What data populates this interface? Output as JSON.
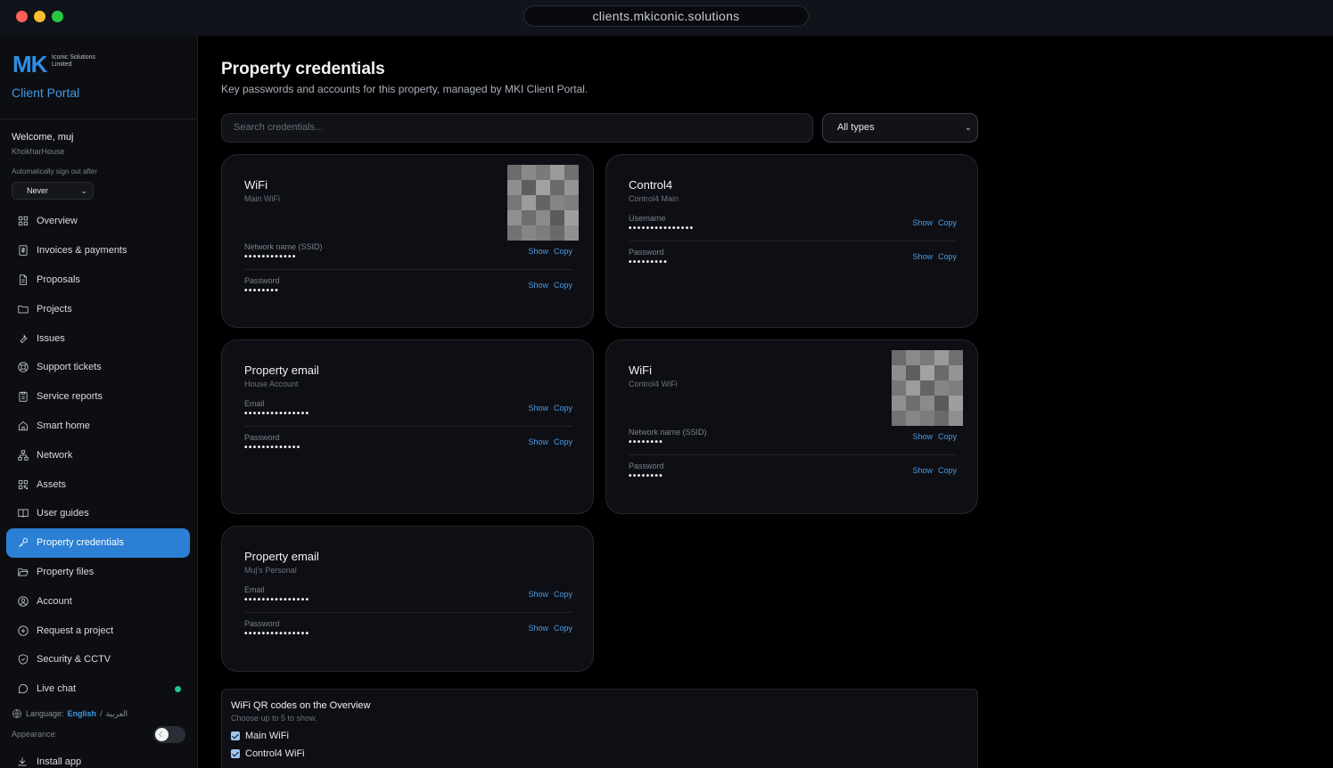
{
  "window": {
    "url": "clients.mkiconic.solutions"
  },
  "brand": {
    "logo_text": "MK",
    "logo_sub": "Iconic Solutions Limited",
    "portal_title": "Client Portal"
  },
  "user": {
    "welcome": "Welcome, muj",
    "property": "KhokharHouse",
    "auto_signout_label": "Automatically sign out after",
    "auto_signout_value": "Never"
  },
  "nav": [
    {
      "label": "Overview",
      "icon": "grid-icon"
    },
    {
      "label": "Invoices & payments",
      "icon": "invoice-icon"
    },
    {
      "label": "Proposals",
      "icon": "document-icon"
    },
    {
      "label": "Projects",
      "icon": "folder-icon"
    },
    {
      "label": "Issues",
      "icon": "wrench-icon"
    },
    {
      "label": "Support tickets",
      "icon": "lifebuoy-icon"
    },
    {
      "label": "Service reports",
      "icon": "clipboard-icon"
    },
    {
      "label": "Smart home",
      "icon": "home-icon"
    },
    {
      "label": "Network",
      "icon": "network-icon"
    },
    {
      "label": "Assets",
      "icon": "qr-grid-icon"
    },
    {
      "label": "User guides",
      "icon": "book-icon"
    },
    {
      "label": "Property credentials",
      "icon": "key-icon",
      "active": true
    },
    {
      "label": "Property files",
      "icon": "folder-open-icon"
    },
    {
      "label": "Account",
      "icon": "user-circle-icon"
    },
    {
      "label": "Request a project",
      "icon": "plus-circle-icon"
    },
    {
      "label": "Security & CCTV",
      "icon": "shield-icon"
    },
    {
      "label": "Live chat",
      "icon": "chat-icon",
      "online": true
    }
  ],
  "footer": {
    "language_label": "Language:",
    "language_en": "English",
    "language_sep": "/",
    "language_ar": "العربية",
    "appearance_label": "Appearance:",
    "install_label": "Install app"
  },
  "page": {
    "title": "Property credentials",
    "subtitle": "Key passwords and accounts for this property, managed by MKI Client Portal.",
    "search_placeholder": "Search credentials...",
    "type_filter": "All types"
  },
  "actions": {
    "show": "Show",
    "copy": "Copy"
  },
  "cards": [
    {
      "title": "WiFi",
      "subtitle": "Main WiFi",
      "has_qr": true,
      "fields": [
        {
          "label": "Network name (SSID)",
          "value": "••••••••••••"
        },
        {
          "label": "Password",
          "value": "••••••••"
        }
      ]
    },
    {
      "title": "Control4",
      "subtitle": "Control4 Main",
      "has_qr": false,
      "fields": [
        {
          "label": "Username",
          "value": "•••••••••••••••"
        },
        {
          "label": "Password",
          "value": "•••••••••"
        }
      ]
    },
    {
      "title": "Property email",
      "subtitle": "House Account",
      "has_qr": false,
      "fields": [
        {
          "label": "Email",
          "value": "•••••••••••••••"
        },
        {
          "label": "Password",
          "value": "•••••••••••••"
        }
      ]
    },
    {
      "title": "WiFi",
      "subtitle": "Control4 WiFi",
      "has_qr": true,
      "fields": [
        {
          "label": "Network name (SSID)",
          "value": "••••••••"
        },
        {
          "label": "Password",
          "value": "••••••••"
        }
      ]
    },
    {
      "title": "Property email",
      "subtitle": "Muj's Personal",
      "has_qr": false,
      "fields": [
        {
          "label": "Email",
          "value": "•••••••••••••••"
        },
        {
          "label": "Password",
          "value": "•••••••••••••••"
        }
      ]
    }
  ],
  "qr_settings": {
    "title": "WiFi QR codes on the Overview",
    "subtitle": "Choose up to 5 to show.",
    "options": [
      {
        "label": "Main WiFi",
        "checked": true
      },
      {
        "label": "Control4 WiFi",
        "checked": true
      }
    ]
  }
}
